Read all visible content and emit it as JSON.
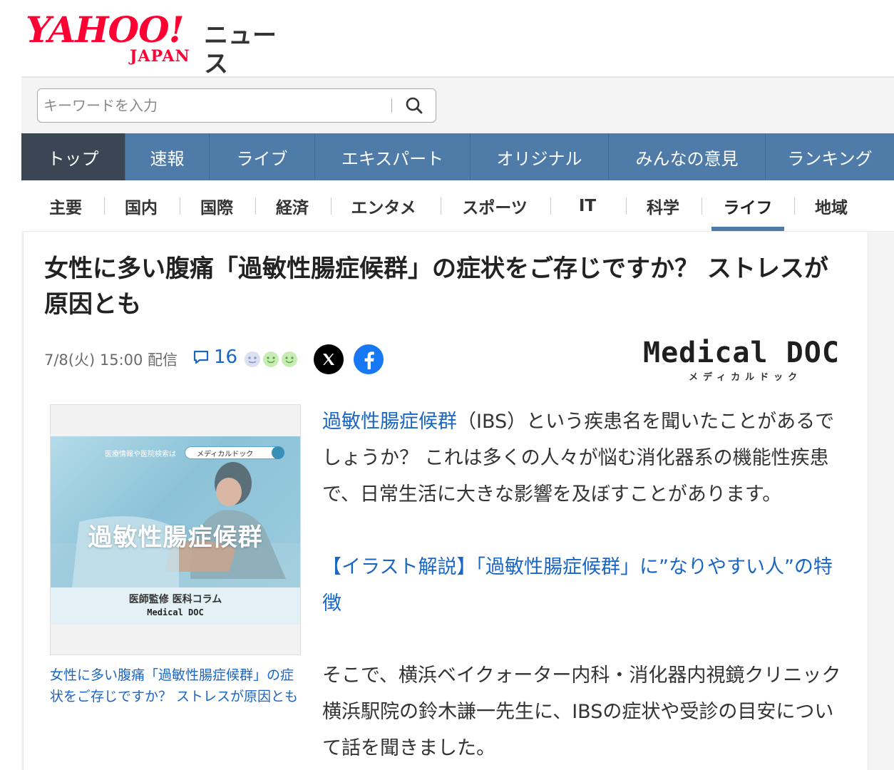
{
  "header": {
    "logo_main": "YAHOO!",
    "logo_sub": "JAPAN",
    "section": "ニュース"
  },
  "search": {
    "placeholder": "キーワードを入力",
    "button_icon": "search-icon"
  },
  "nav_main": {
    "items": [
      "トップ",
      "速報",
      "ライブ",
      "エキスパート",
      "オリジナル",
      "みんなの意見",
      "ランキング"
    ],
    "active": "トップ",
    "color": "#4e7ba8",
    "active_color": "#3b4654"
  },
  "nav_sub": {
    "items": [
      "主要",
      "国内",
      "国際",
      "経済",
      "エンタメ",
      "スポーツ",
      "IT",
      "科学",
      "ライフ",
      "地域"
    ],
    "active": "ライフ"
  },
  "article": {
    "title": "女性に多い腹痛「過敏性腸症候群」の症状をご存じですか？ ストレスが原因とも",
    "date": "7/8(火) 15:00 配信",
    "comment_count": "16",
    "provider": {
      "name": "Medical DOC",
      "sub": "メディカルドック"
    },
    "image": {
      "search_lead": "医療情報や医院検索は",
      "search_label": "メディカルドック",
      "title": "過敏性腸症候群",
      "footer": "医師監修 医科コラム",
      "brand": "Medical DOC"
    },
    "caption": "女性に多い腹痛「過敏性腸症候群」の症状をご存じですか？ ストレスが原因とも",
    "p1_link": "過敏性腸症候群",
    "p1_rest": "（IBS）という疾患名を聞いたことがあるでしょうか？ これは多くの人々が悩む消化器系の機能性疾患で、日常生活に大きな影響を及ぼすことがあります。",
    "p2": "【イラスト解説】「過敏性腸症候群」に”なりやすい人”の特徴",
    "p3": "そこで、横浜ベイクォーター内科・消化器内視鏡クリニック 横浜駅院の鈴木謙一先生に、IBSの症状や受診の目安について話を聞きました。"
  },
  "colors": {
    "link": "#1a66c4",
    "brand": "#ff0033"
  }
}
